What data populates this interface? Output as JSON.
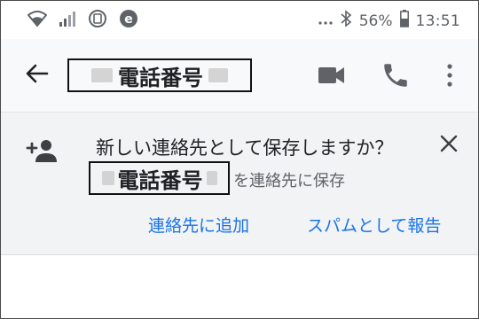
{
  "status_bar": {
    "battery": "56%",
    "time": "13:51",
    "icons": [
      "wifi-icon",
      "signal-icon",
      "sim-icon",
      "e-app-icon",
      "more-dots-icon",
      "bluetooth-icon",
      "battery-icon"
    ]
  },
  "app_bar": {
    "title": "電話番号",
    "icons": [
      "back-arrow-icon",
      "video-call-icon",
      "phone-icon",
      "more-vert-icon"
    ]
  },
  "banner": {
    "question": "新しい連絡先として保存しますか？",
    "number": "電話番号",
    "suffix": "を連絡先に保存",
    "add_contact_label": "連絡先に追加",
    "report_spam_label": "スパムとして報告",
    "icons": [
      "add-person-icon",
      "close-icon"
    ]
  },
  "colors": {
    "accent": "#1a73e8",
    "appbar_bg": "#f8f9fa",
    "banner_bg": "#f1f3f4",
    "icon_gray": "#5f6368"
  }
}
